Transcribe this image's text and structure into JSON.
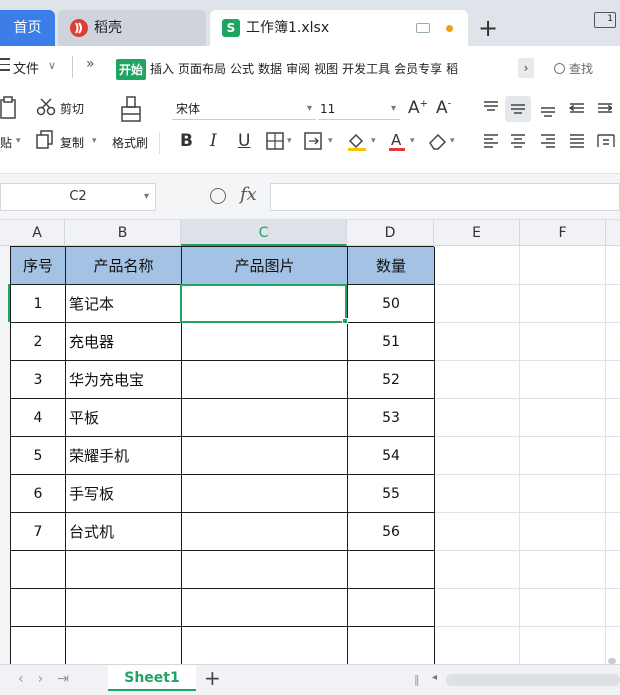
{
  "tabs": {
    "home": "首页",
    "daoke": "稻壳",
    "workbook": "工作簿1.xlsx",
    "workbook_icon": "S"
  },
  "window": {
    "indicator": "1"
  },
  "menu": {
    "file": "文件",
    "start": "开始",
    "items": [
      "插入",
      "页面布局",
      "公式",
      "数据",
      "审阅",
      "视图",
      "开发工具",
      "会员专享",
      "稻"
    ],
    "search": "查找"
  },
  "toolbar": {
    "cut": "剪切",
    "paste": "贴",
    "copy": "复制",
    "format_painter": "格式刷",
    "font_name": "宋体",
    "font_size": "11",
    "bold": "B",
    "italic": "I",
    "underline": "U"
  },
  "formula_bar": {
    "name_box": "C2",
    "fx": "fx",
    "value": ""
  },
  "columns": [
    "A",
    "B",
    "C",
    "D",
    "E",
    "F"
  ],
  "selected_column": "C",
  "table": {
    "headers": [
      "序号",
      "产品名称",
      "产品图片",
      "数量"
    ],
    "rows": [
      [
        "1",
        "笔记本",
        "",
        "50"
      ],
      [
        "2",
        "充电器",
        "",
        "51"
      ],
      [
        "3",
        "华为充电宝",
        "",
        "52"
      ],
      [
        "4",
        "平板",
        "",
        "53"
      ],
      [
        "5",
        "荣耀手机",
        "",
        "54"
      ],
      [
        "6",
        "手写板",
        "",
        "55"
      ],
      [
        "7",
        "台式机",
        "",
        "56"
      ]
    ]
  },
  "sheet_tabs": {
    "active": "Sheet1"
  },
  "colors": {
    "accent": "#1fa463",
    "header_fill": "#a4c2e4",
    "home_tab": "#3c7ee8"
  }
}
